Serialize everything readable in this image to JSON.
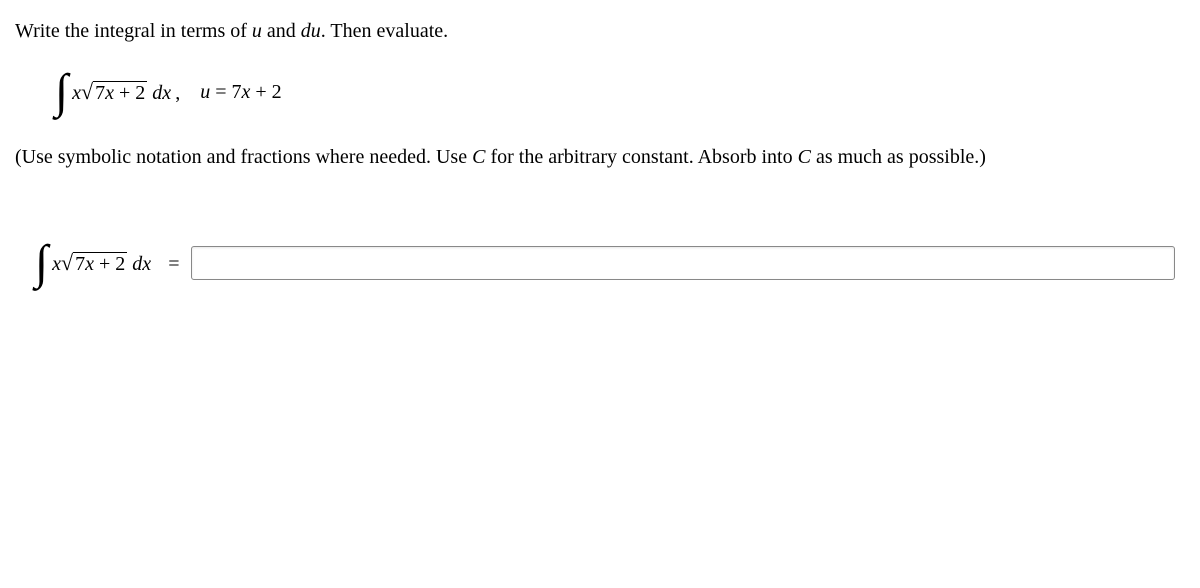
{
  "instruction_prefix": "Write the integral in terms of ",
  "var_u": "u",
  "instruction_mid": " and ",
  "var_du": "du",
  "instruction_suffix": ". Then evaluate.",
  "integral": {
    "integrand_x": "x",
    "sqrt_inner_coeff": "7",
    "sqrt_inner_var": "x",
    "sqrt_inner_plus": " + 2",
    "dx": " dx",
    "comma": ",",
    "sub_lhs": "u",
    "sub_eq": " = ",
    "sub_rhs_coeff": "7",
    "sub_rhs_var": "x",
    "sub_rhs_plus": " + 2"
  },
  "note_prefix": "(Use symbolic notation and fractions where needed. Use ",
  "note_C1": "C",
  "note_mid": " for the arbitrary constant. Absorb into ",
  "note_C2": "C",
  "note_suffix": " as much as possible.)",
  "answer": {
    "integrand_x": "x",
    "sqrt_inner_coeff": "7",
    "sqrt_inner_var": "x",
    "sqrt_inner_plus": " + 2",
    "dx": " dx",
    "equals": " ="
  }
}
